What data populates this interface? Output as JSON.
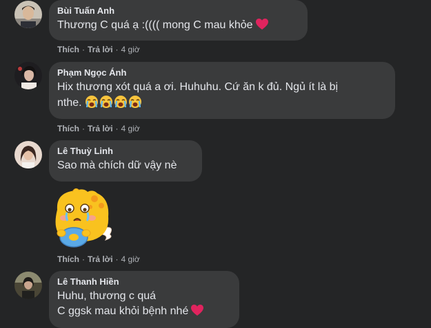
{
  "comments": [
    {
      "author": "Bùi Tuấn Anh",
      "lines": [
        "Thương C quá ạ :(((( mong C mau khỏe"
      ],
      "emoji": "red-heart",
      "actions": {
        "like": "Thích",
        "reply": "Trả lời",
        "time": "4 giờ"
      }
    },
    {
      "author": "Phạm Ngọc Ánh",
      "lines": [
        "Hix thương xót quá a ơi. Huhuhu. Cứ ăn k đủ. Ngủ ít là bị",
        "nthe."
      ],
      "emoji": "loudly-crying-face x4",
      "actions": {
        "like": "Thích",
        "reply": "Trả lời",
        "time": "4 giờ"
      }
    },
    {
      "author": "Lê Thuỳ Linh",
      "lines": [
        "Sao mà chích dữ vậy nè"
      ],
      "actions": {
        "like": "Thích",
        "reply": "Trả lời",
        "time": "4 giờ"
      },
      "sticker": "crying-yellow-creature-sticker",
      "sticker_actions": {
        "like": "Thích",
        "reply": "Trả lời",
        "time": "4 giờ"
      }
    },
    {
      "author": "Lê Thanh Hiền",
      "lines": [
        "Huhu, thương c quá",
        "C ggsk mau khỏi bệnh nhé"
      ],
      "emoji": "red-heart"
    }
  ],
  "colors": {
    "background": "#242526",
    "bubble": "#3a3b3c",
    "text": "#e4e6eb",
    "secondary_text": "#b0b3b8",
    "heart": "#e0245e"
  }
}
